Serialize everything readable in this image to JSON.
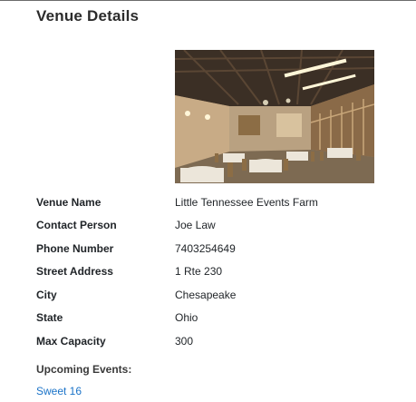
{
  "page": {
    "title": "Venue Details"
  },
  "photo": {
    "description_icon": "venue-photo",
    "colors": {
      "ceiling": "#3b2f25",
      "wall": "#b9a181",
      "floor": "#7d6a52",
      "table_cloth": "#ece6da",
      "chair": "#8c6d45",
      "light": "#fff6d8"
    }
  },
  "details": {
    "rows": [
      {
        "label": "Venue Name",
        "value": "Little Tennessee Events Farm"
      },
      {
        "label": "Contact Person",
        "value": "Joe Law"
      },
      {
        "label": "Phone Number",
        "value": "7403254649"
      },
      {
        "label": "Street Address",
        "value": "1 Rte 230"
      },
      {
        "label": "City",
        "value": "Chesapeake"
      },
      {
        "label": "State",
        "value": "Ohio"
      },
      {
        "label": "Max Capacity",
        "value": "300"
      }
    ]
  },
  "events": {
    "heading": "Upcoming Events:",
    "items": [
      {
        "name": "Sweet 16"
      }
    ]
  },
  "colors": {
    "link": "#1a73c8",
    "text": "#212529"
  }
}
